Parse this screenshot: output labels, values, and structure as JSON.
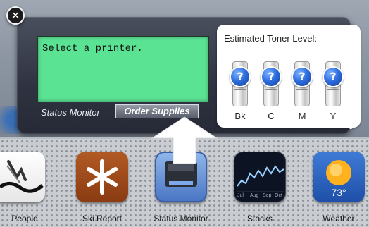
{
  "widget": {
    "close_icon": "close-icon",
    "display_message": "Select a printer.",
    "status_title": "Status Monitor",
    "order_button_label": "Order Supplies",
    "screen_color": "#5be394",
    "info_icon": "i"
  },
  "toner": {
    "title": "Estimated Toner Level:",
    "status_symbol": "?",
    "cartridges": [
      {
        "label": "Bk"
      },
      {
        "label": "C"
      },
      {
        "label": "M"
      },
      {
        "label": "Y"
      }
    ]
  },
  "tray": {
    "apps": [
      {
        "label": "People",
        "icon": "people-icon"
      },
      {
        "label": "Ski Report",
        "icon": "snowflake-icon"
      },
      {
        "label": "Status Monitor",
        "icon": "printer-icon"
      },
      {
        "label": "Stocks",
        "icon": "stocks-chart-icon",
        "axis_labels": [
          "Jul",
          "Aug",
          "Sep",
          "Oct"
        ]
      },
      {
        "label": "Weather",
        "icon": "weather-sun-icon",
        "temperature": "73°"
      }
    ]
  }
}
